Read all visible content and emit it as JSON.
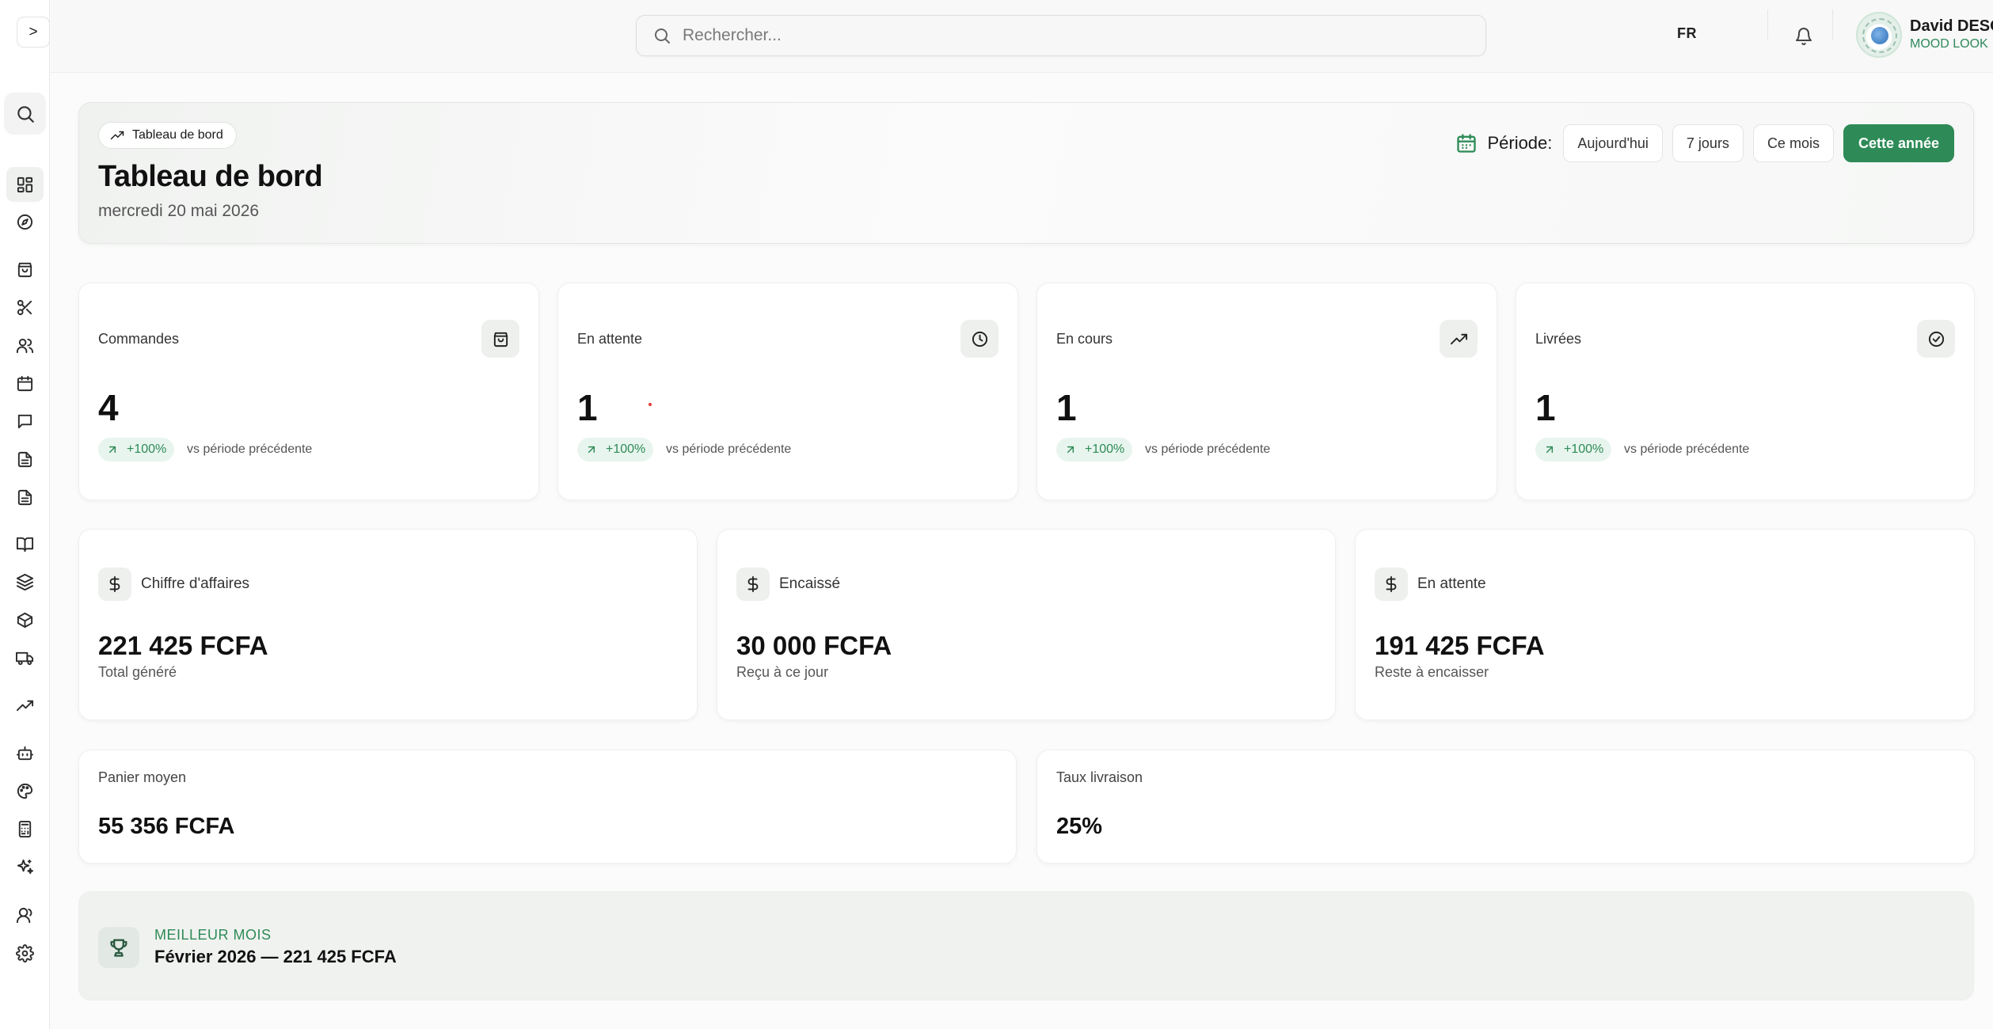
{
  "sidebar": {
    "toggle_label": ">",
    "items": [
      {
        "name": "dashboard",
        "icon": "grid-icon"
      },
      {
        "name": "explore",
        "icon": "compass-icon"
      },
      {
        "name": "orders",
        "icon": "shopping-bag-icon"
      },
      {
        "name": "tailoring",
        "icon": "scissors-icon"
      },
      {
        "name": "clients",
        "icon": "users-icon"
      },
      {
        "name": "calendar",
        "icon": "calendar-icon"
      },
      {
        "name": "messages",
        "icon": "message-icon"
      },
      {
        "name": "invoices",
        "icon": "file-text-icon"
      },
      {
        "name": "quotes",
        "icon": "file-text-icon"
      },
      {
        "name": "catalog",
        "icon": "book-open-icon"
      },
      {
        "name": "collections",
        "icon": "layers-icon"
      },
      {
        "name": "stock",
        "icon": "package-icon"
      },
      {
        "name": "deliveries",
        "icon": "truck-icon"
      },
      {
        "name": "analytics",
        "icon": "trending-up-icon"
      },
      {
        "name": "assistant",
        "icon": "bot-icon"
      },
      {
        "name": "design",
        "icon": "palette-icon"
      },
      {
        "name": "calculator",
        "icon": "calculator-icon"
      },
      {
        "name": "ai-tools",
        "icon": "sparkles-icon"
      },
      {
        "name": "team",
        "icon": "user-icon"
      },
      {
        "name": "settings",
        "icon": "settings-icon"
      }
    ]
  },
  "topbar": {
    "search_placeholder": "Rechercher...",
    "language": "FR",
    "user": {
      "name": "David DESOU",
      "company": "MOOD LOOK"
    }
  },
  "header": {
    "breadcrumb": "Tableau de bord",
    "title": "Tableau de bord",
    "date": "mercredi 20 mai 2026",
    "period_label": "Période:",
    "periods": [
      "Aujourd'hui",
      "7 jours",
      "Ce mois",
      "Cette année"
    ],
    "active_period": "Cette année"
  },
  "stats": [
    {
      "label": "Commandes",
      "value": "4",
      "trend": "+100%",
      "vs": "vs période précédente",
      "icon": "shopping-bag-icon"
    },
    {
      "label": "En attente",
      "value": "1",
      "trend": "+100%",
      "vs": "vs période précédente",
      "icon": "clock-icon"
    },
    {
      "label": "En cours",
      "value": "1",
      "trend": "+100%",
      "vs": "vs période précédente",
      "icon": "trending-up-icon"
    },
    {
      "label": "Livrées",
      "value": "1",
      "trend": "+100%",
      "vs": "vs période précédente",
      "icon": "check-circle-icon"
    }
  ],
  "money": [
    {
      "label": "Chiffre d'affaires",
      "value": "221 425 FCFA",
      "sub": "Total généré",
      "icon": "dollar-icon"
    },
    {
      "label": "Encaissé",
      "value": "30 000 FCFA",
      "sub": "Reçu à ce jour",
      "icon": "dollar-icon"
    },
    {
      "label": "En attente",
      "value": "191 425 FCFA",
      "sub": "Reste à encaisser",
      "icon": "dollar-icon"
    }
  ],
  "small": [
    {
      "label": "Panier moyen",
      "value": "55 356 FCFA"
    },
    {
      "label": "Taux livraison",
      "value": "25%"
    }
  ],
  "best_month": {
    "label": "MEILLEUR MOIS",
    "value": "Février 2026 — 221 425 FCFA",
    "icon": "trophy-icon"
  },
  "colors": {
    "accent": "#2e8b57",
    "trend_bg": "#e8f5ee"
  }
}
